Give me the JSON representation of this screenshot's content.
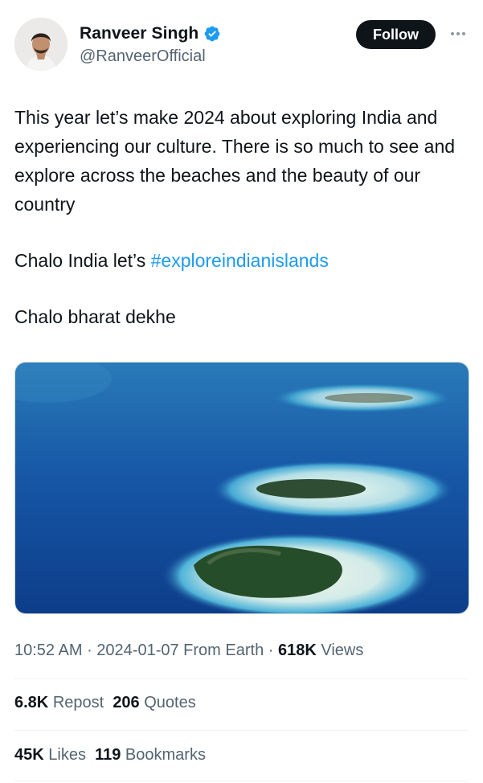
{
  "user": {
    "display_name": "Ranveer Singh",
    "handle": "@RanveerOfficial",
    "verified": true
  },
  "follow_label": "Follow",
  "tweet": {
    "paragraph1": "This year let’s make 2024 about exploring India and experiencing our culture. There is so much to see and explore across the beaches and the beauty of our country",
    "paragraph2_prefix": "Chalo India let’s ",
    "hashtag": "#exploreindianislands",
    "paragraph3": "Chalo bharat dekhe"
  },
  "meta": {
    "time": "10:52 AM",
    "date": "2024-01-07",
    "location": "From Earth",
    "views_count": "618K",
    "views_label": "Views"
  },
  "stats": {
    "reposts_count": "6.8K",
    "reposts_label": "Repost",
    "quotes_count": "206",
    "quotes_label": "Quotes",
    "likes_count": "45K",
    "likes_label": "Likes",
    "bookmarks_count": "119",
    "bookmarks_label": "Bookmarks"
  },
  "colors": {
    "link": "#1d9bf0",
    "verified": "#1d9bf0",
    "secondary_text": "#536471",
    "primary_text": "#0f1419",
    "follow_button": "#0f1419"
  }
}
